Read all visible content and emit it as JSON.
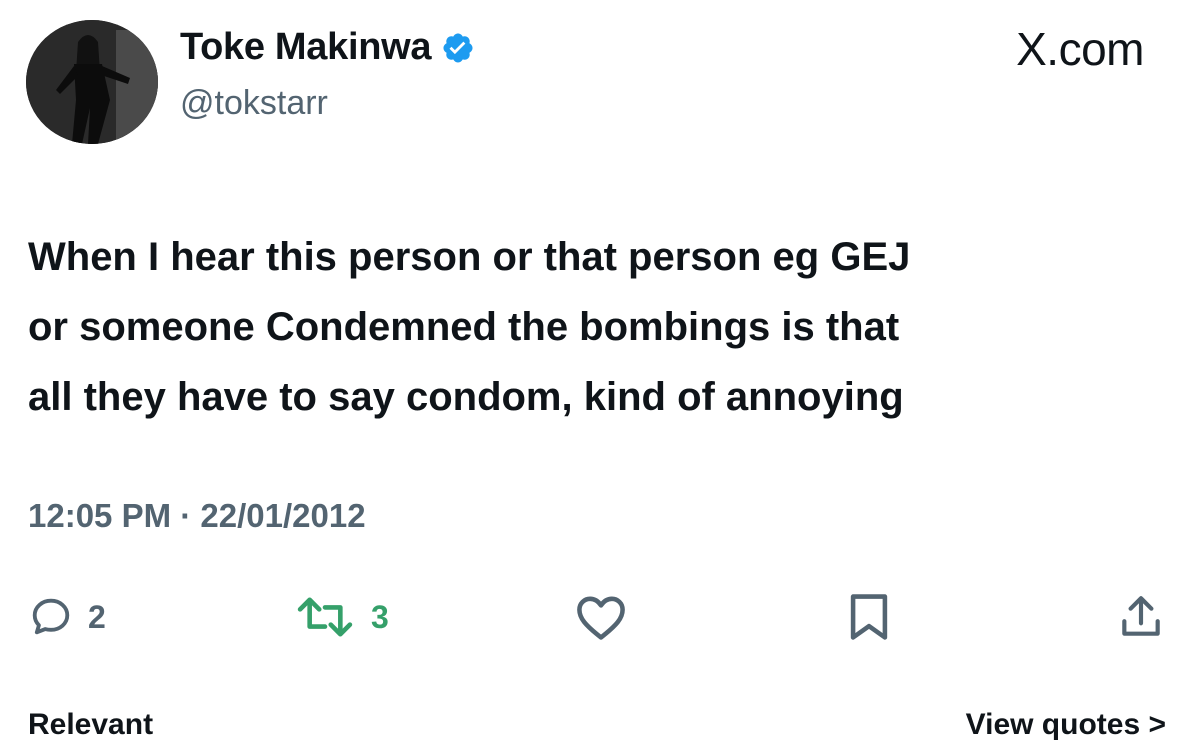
{
  "header": {
    "display_name": "Toke Makinwa",
    "handle": "@tokstarr",
    "brand": "X.com",
    "verified": true,
    "verified_color": "#1d9bf0"
  },
  "tweet": {
    "lines": [
      "When I hear this person or that person eg GEJ",
      "or someone Condemned the bombings is that",
      "all they have to say condom, kind of annoying"
    ],
    "timestamp": "12:05 PM · 22/01/2012"
  },
  "actions": {
    "reply_count": "2",
    "retweet_count": "3",
    "retweet_color": "#35a06a",
    "icons": [
      "reply-icon",
      "retweet-icon",
      "like-icon",
      "bookmark-icon",
      "share-icon"
    ]
  },
  "footer": {
    "left_label": "Relevant",
    "right_label": "View quotes >"
  }
}
